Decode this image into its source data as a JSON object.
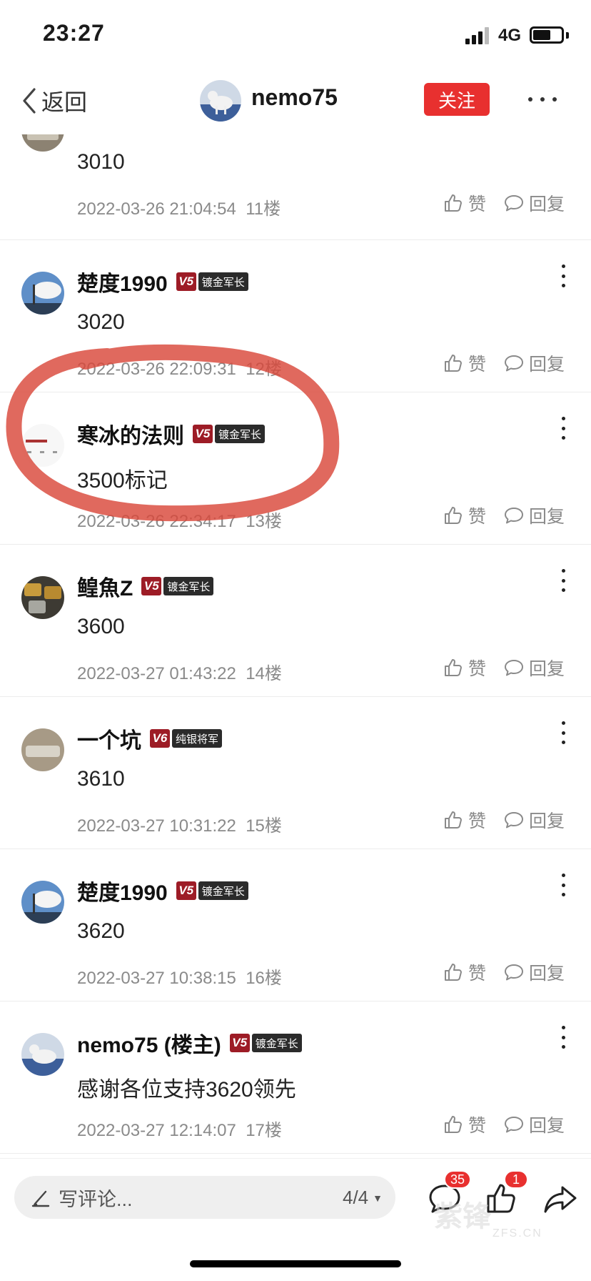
{
  "status_bar": {
    "time": "23:27",
    "network": "4G"
  },
  "nav": {
    "back_label": "返回",
    "title": "nemo75",
    "follow_label": "关注"
  },
  "comments": [
    {
      "user": "",
      "content": "3010",
      "timestamp": "2022-03-26 21:04:54",
      "floor": "11楼",
      "level": "",
      "title": ""
    },
    {
      "user": "楚度1990",
      "content": "3020",
      "timestamp": "2022-03-26 22:09:31",
      "floor": "12楼",
      "level": "V5",
      "title": "镀金军长"
    },
    {
      "user": "寒冰的法则",
      "content": "3500标记",
      "timestamp": "2022-03-26 22:34:17",
      "floor": "13楼",
      "level": "V5",
      "title": "镀金军长"
    },
    {
      "user": "鳇魚Z",
      "content": "3600",
      "timestamp": "2022-03-27 01:43:22",
      "floor": "14楼",
      "level": "V5",
      "title": "镀金军长"
    },
    {
      "user": "一个坑",
      "content": "3610",
      "timestamp": "2022-03-27 10:31:22",
      "floor": "15楼",
      "level": "V6",
      "title": "纯银将军"
    },
    {
      "user": "楚度1990",
      "content": "3620",
      "timestamp": "2022-03-27 10:38:15",
      "floor": "16楼",
      "level": "V5",
      "title": "镀金军长"
    },
    {
      "user": "nemo75 (楼主)",
      "content": "感谢各位支持3620领先",
      "timestamp": "2022-03-27 12:14:07",
      "floor": "17楼",
      "level": "V5",
      "title": "镀金军长"
    }
  ],
  "actions": {
    "like_label": "赞",
    "reply_label": "回复"
  },
  "bottom_bar": {
    "input_placeholder": "写评论...",
    "page_indicator": "4/4",
    "comment_count": "35",
    "like_count": "1",
    "watermark": "紫锋",
    "watermark_sub": "ZFS.CN"
  },
  "colors": {
    "accent": "#e8302f",
    "level_badge": "#9d1c26",
    "title_badge": "#2b2b2b",
    "highlight": "#d9483b"
  },
  "icons": [
    "back-chevron-icon",
    "more-icon",
    "thumbs-up-icon",
    "reply-bubble-icon",
    "pencil-icon",
    "comment-icon",
    "share-icon"
  ]
}
